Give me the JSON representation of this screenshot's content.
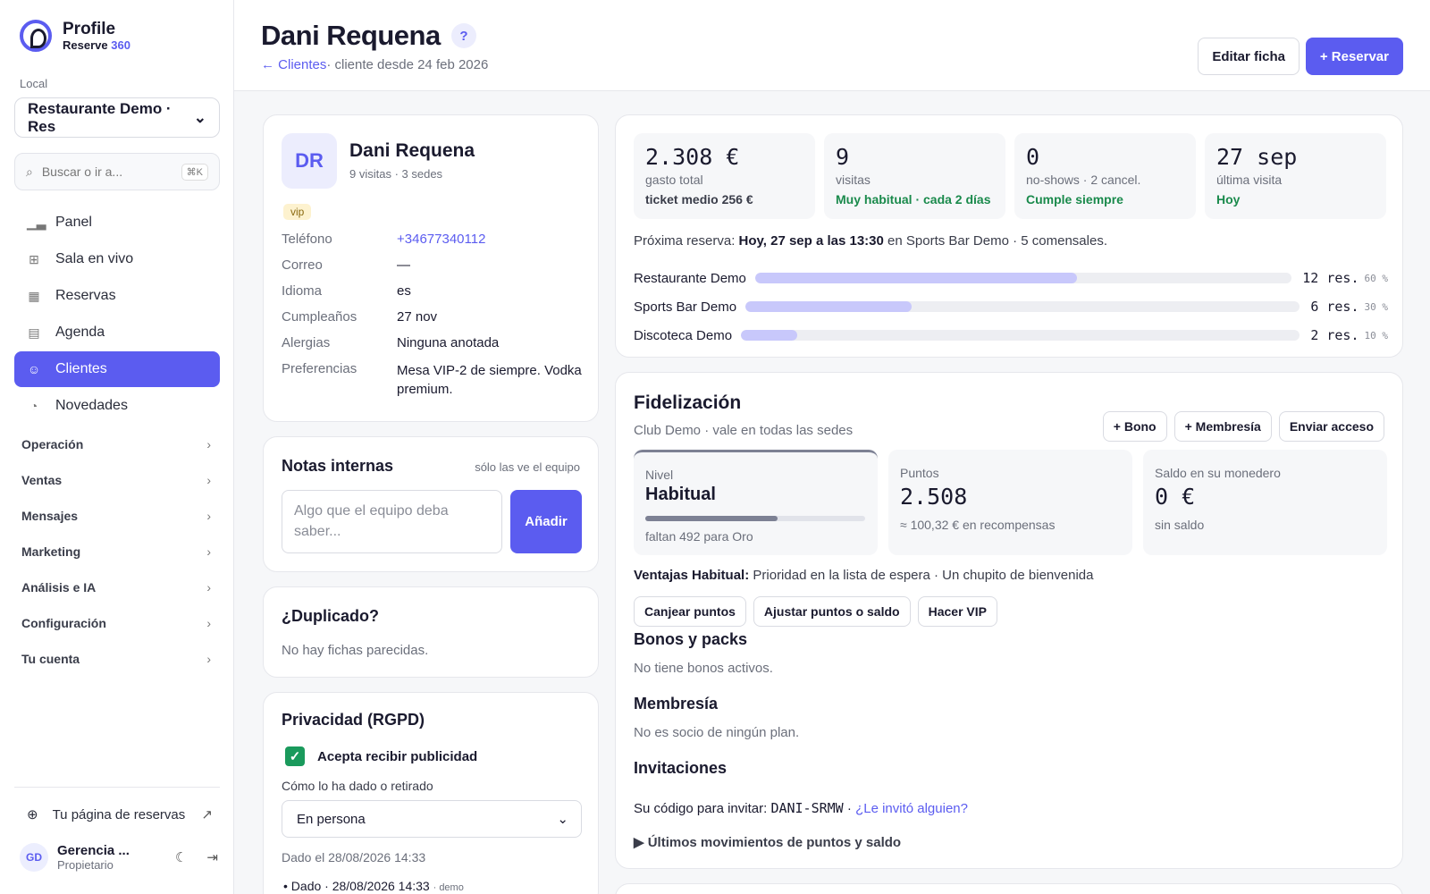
{
  "brand": {
    "name": "Profile",
    "sub": "Reserve",
    "sub_accent": "360"
  },
  "sidebar": {
    "local_label": "Local",
    "local_value": "Restaurante Demo · Res",
    "search_placeholder": "Buscar o ir a...",
    "search_kbd": "⌘K",
    "nav": [
      {
        "label": "Panel",
        "icon": "chart-icon"
      },
      {
        "label": "Sala en vivo",
        "icon": "grid-icon"
      },
      {
        "label": "Reservas",
        "icon": "calendar-icon"
      },
      {
        "label": "Agenda",
        "icon": "table-icon"
      },
      {
        "label": "Clientes",
        "icon": "users-icon",
        "active": true
      },
      {
        "label": "Novedades",
        "icon": "bell-icon"
      }
    ],
    "groups": [
      "Operación",
      "Ventas",
      "Mensajes",
      "Marketing",
      "Análisis e IA",
      "Configuración",
      "Tu cuenta"
    ],
    "public_link": "Tu página de reservas",
    "user": {
      "initials": "GD",
      "name": "Gerencia ...",
      "role": "Propietario"
    }
  },
  "header": {
    "title": "Dani Requena",
    "back_link": "← Clientes",
    "since": "· cliente desde 24 feb 2026",
    "edit": "Editar ficha",
    "reserve": "+ Reservar"
  },
  "profile": {
    "initials": "DR",
    "name": "Dani Requena",
    "visits": "9 visitas · 3 sedes",
    "tag": "vip",
    "fields": [
      {
        "k": "Teléfono",
        "v": "+34677340112",
        "link": true
      },
      {
        "k": "Correo",
        "v": "—"
      },
      {
        "k": "Idioma",
        "v": "es"
      },
      {
        "k": "Cumpleaños",
        "v": "27 nov"
      },
      {
        "k": "Alergias",
        "v": "Ninguna anotada"
      },
      {
        "k": "Preferencias",
        "v": "Mesa VIP-2 de siempre. Vodka premium."
      }
    ]
  },
  "notes": {
    "title": "Notas internas",
    "hint": "sólo las ve el equipo",
    "placeholder": "Algo que el equipo deba saber...",
    "button": "Añadir"
  },
  "duplicate": {
    "title": "¿Duplicado?",
    "text": "No hay fichas parecidas."
  },
  "privacy": {
    "title": "Privacidad (RGPD)",
    "consent": "Acepta recibir publicidad",
    "how_label": "Cómo lo ha dado o retirado",
    "how_value": "En persona",
    "date": "Dado el 28/08/2026 14:33",
    "history": "Dado · 28/08/2026 14:33",
    "history_note": "· demo"
  },
  "stats": [
    {
      "big": "2.308 €",
      "label": "gasto total",
      "sub": "ticket medio 256 €",
      "tone": "dark"
    },
    {
      "big": "9",
      "label": "visitas",
      "sub": "Muy habitual · cada 2 días",
      "tone": "green"
    },
    {
      "big": "0",
      "label": "no-shows · 2 cancel.",
      "sub": "Cumple siempre",
      "tone": "green"
    },
    {
      "big": "27 sep",
      "label": "última visita",
      "sub": "Hoy",
      "tone": "green"
    }
  ],
  "next_reservation": {
    "prefix": "Próxima reserva:",
    "when": "Hoy, 27 sep a las 13:30",
    "suffix": "en Sports Bar Demo · 5 comensales."
  },
  "venues": [
    {
      "name": "Restaurante Demo",
      "count": "12 res.",
      "pct": "60 %",
      "fraction": 0.6
    },
    {
      "name": "Sports Bar Demo",
      "count": "6 res.",
      "pct": "30 %",
      "fraction": 0.3
    },
    {
      "name": "Discoteca Demo",
      "count": "2 res.",
      "pct": "10 %",
      "fraction": 0.1
    }
  ],
  "loyalty": {
    "title": "Fidelización",
    "subtitle": "Club Demo · vale en todas las sedes",
    "buttons": [
      "+ Bono",
      "+ Membresía",
      "Enviar acceso"
    ],
    "level_label": "Nivel",
    "level": "Habitual",
    "level_progress": 0.6,
    "level_note": "faltan 492 para Oro",
    "points_label": "Puntos",
    "points": "2.508",
    "points_note": "≈ 100,32 € en recompensas",
    "wallet_label": "Saldo en su monedero",
    "wallet": "0 €",
    "wallet_note": "sin saldo",
    "perks_label": "Ventajas Habitual:",
    "perks": "Prioridad en la lista de espera · Un chupito de bienvenida",
    "actions": [
      "Canjear puntos",
      "Ajustar puntos o saldo",
      "Hacer VIP"
    ],
    "bonos_title": "Bonos y packs",
    "bonos_text": "No tiene bonos activos.",
    "membership_title": "Membresía",
    "membership_text": "No es socio de ningún plan.",
    "invites_title": "Invitaciones",
    "invite_prefix": "Su código para invitar:",
    "invite_code": "DANI-SRMW",
    "invite_link": "¿Le invitó alguien?",
    "movements": "▶ Últimos movimientos de puntos y saldo"
  }
}
